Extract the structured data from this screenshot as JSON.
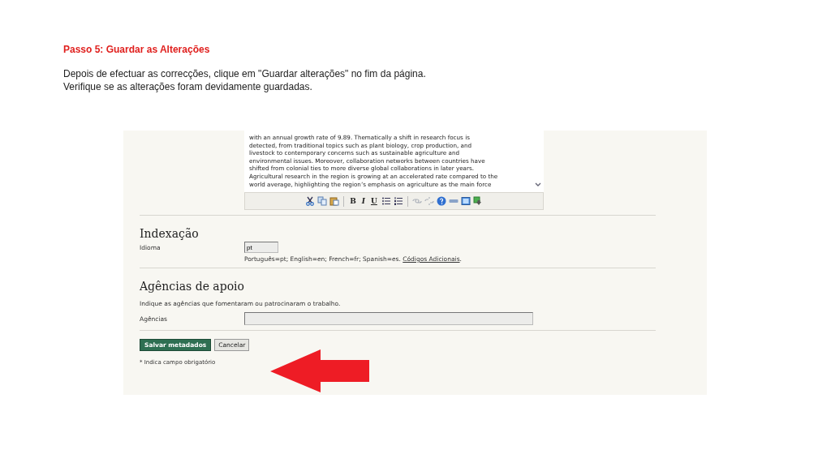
{
  "slide": {
    "title": "Passo 5: Guardar as Alterações",
    "paragraph_lines": [
      "Depois de efectuar as correcções, clique em \"Guardar alterações\" no fim da página.",
      "Verifique se as alterações foram devidamente guardadas."
    ]
  },
  "screenshot": {
    "editor": {
      "lines": [
        "with an annual growth rate of 9.89.  Thematically a shift in research focus is",
        "detected, from traditional topics such as plant biology, crop production, and",
        "livestock to contemporary concerns such as sustainable agriculture and",
        "environmental issues. Moreover, collaboration networks between countries have",
        "shifted from colonial ties to more diverse global collaborations in later years.",
        "Agricultural research in the region is growing at an accelerated rate compared to the",
        "world average, highlighting the region’s emphasis on agriculture as the main force"
      ],
      "format_buttons": [
        {
          "label": "B",
          "kind": "bold"
        },
        {
          "label": "I",
          "kind": "italic"
        },
        {
          "label": "U",
          "kind": "underline"
        }
      ],
      "link_buttons": [
        {
          "kind": "link",
          "disabled": true
        },
        {
          "kind": "unlink",
          "disabled": true
        }
      ]
    },
    "indexing": {
      "heading": "Indexação",
      "label": "Idioma",
      "value": "pt",
      "help": "Português=pt; English=en; French=fr; Spanish=es.",
      "help_link": "Códigos Adicionais",
      "help_end": "."
    },
    "agencies": {
      "heading": "Agências de apoio",
      "instruction": "Indique as agências que fomentaram ou patrocinaram o trabalho.",
      "label": "Agências"
    },
    "buttons": [
      {
        "label": "Salvar metadados",
        "kind": "primary"
      },
      {
        "label": "Cancelar",
        "kind": "secondary"
      }
    ],
    "footnote": "* Indica campo obrigatório"
  }
}
